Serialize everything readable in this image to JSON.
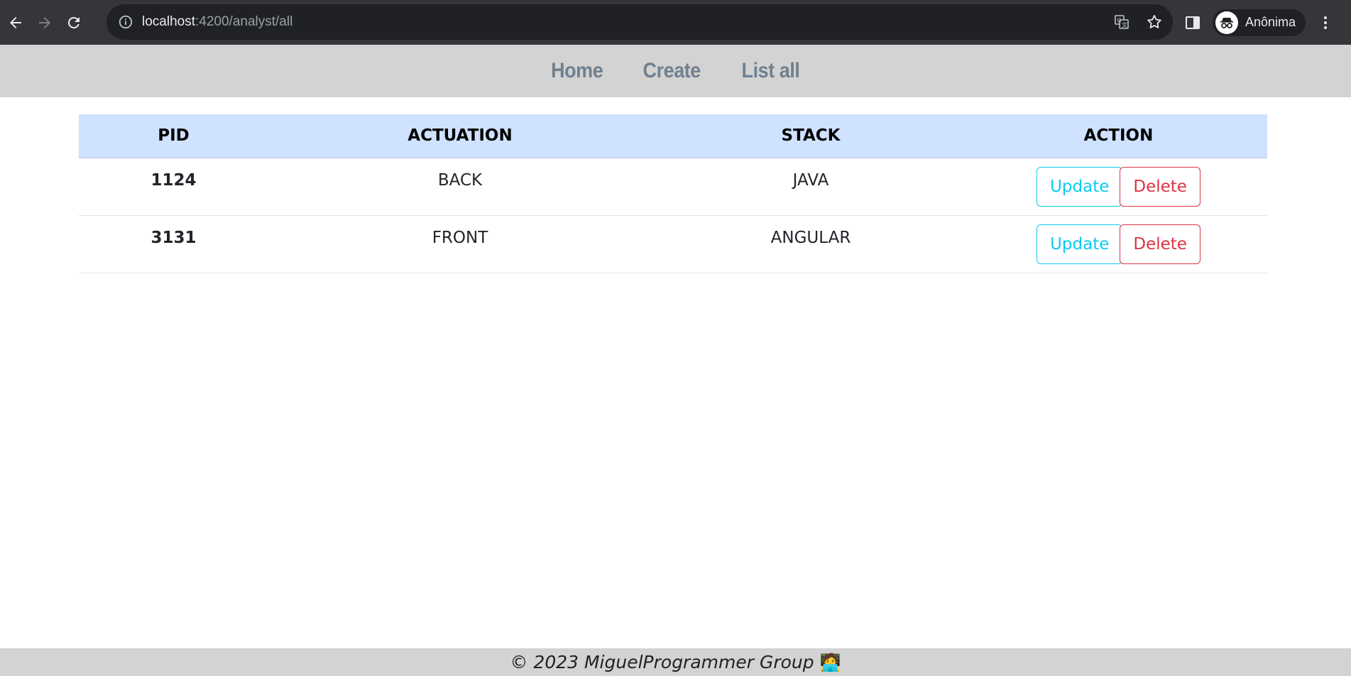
{
  "browser": {
    "url_host": "localhost",
    "url_rest": ":4200/analyst/all",
    "profile_label": "Anônima"
  },
  "nav": {
    "home": "Home",
    "create": "Create",
    "list_all": "List all"
  },
  "table": {
    "headers": [
      "PID",
      "ACTUATION",
      "STACK",
      "ACTION"
    ],
    "rows": [
      {
        "pid": "1124",
        "actuation": "BACK",
        "stack": "JAVA",
        "update_label": "Update",
        "delete_label": "Delete"
      },
      {
        "pid": "3131",
        "actuation": "FRONT",
        "stack": "ANGULAR",
        "update_label": "Update",
        "delete_label": "Delete"
      }
    ]
  },
  "footer": {
    "text": "© 2023 MiguelProgrammer Group",
    "emoji": "🧑‍💻"
  },
  "colors": {
    "nav_link": "#708090",
    "table_header_bg": "#cfe2ff",
    "update": "#0dcaf0",
    "delete": "#dc3545"
  }
}
